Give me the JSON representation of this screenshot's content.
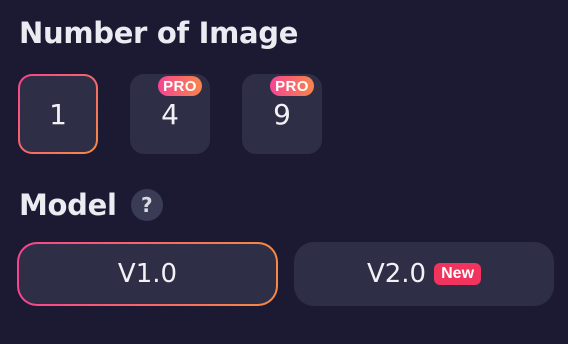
{
  "number_of_image": {
    "title": "Number of Image",
    "options": [
      {
        "label": "1",
        "selected": true,
        "badge": ""
      },
      {
        "label": "4",
        "selected": false,
        "badge": "PRO"
      },
      {
        "label": "9",
        "selected": false,
        "badge": "PRO"
      }
    ]
  },
  "model": {
    "title": "Model",
    "help_glyph": "?",
    "options": [
      {
        "label": "V1.0",
        "selected": true,
        "badge": ""
      },
      {
        "label": "V2.0",
        "selected": false,
        "badge": "New"
      }
    ]
  },
  "colors": {
    "background": "#1b1a32",
    "button_bg": "#2e2e46",
    "gradient_start": "#f5458f",
    "gradient_end": "#f78a42",
    "new_badge": "#f0345d"
  },
  "icons": {
    "help": "help-icon"
  }
}
